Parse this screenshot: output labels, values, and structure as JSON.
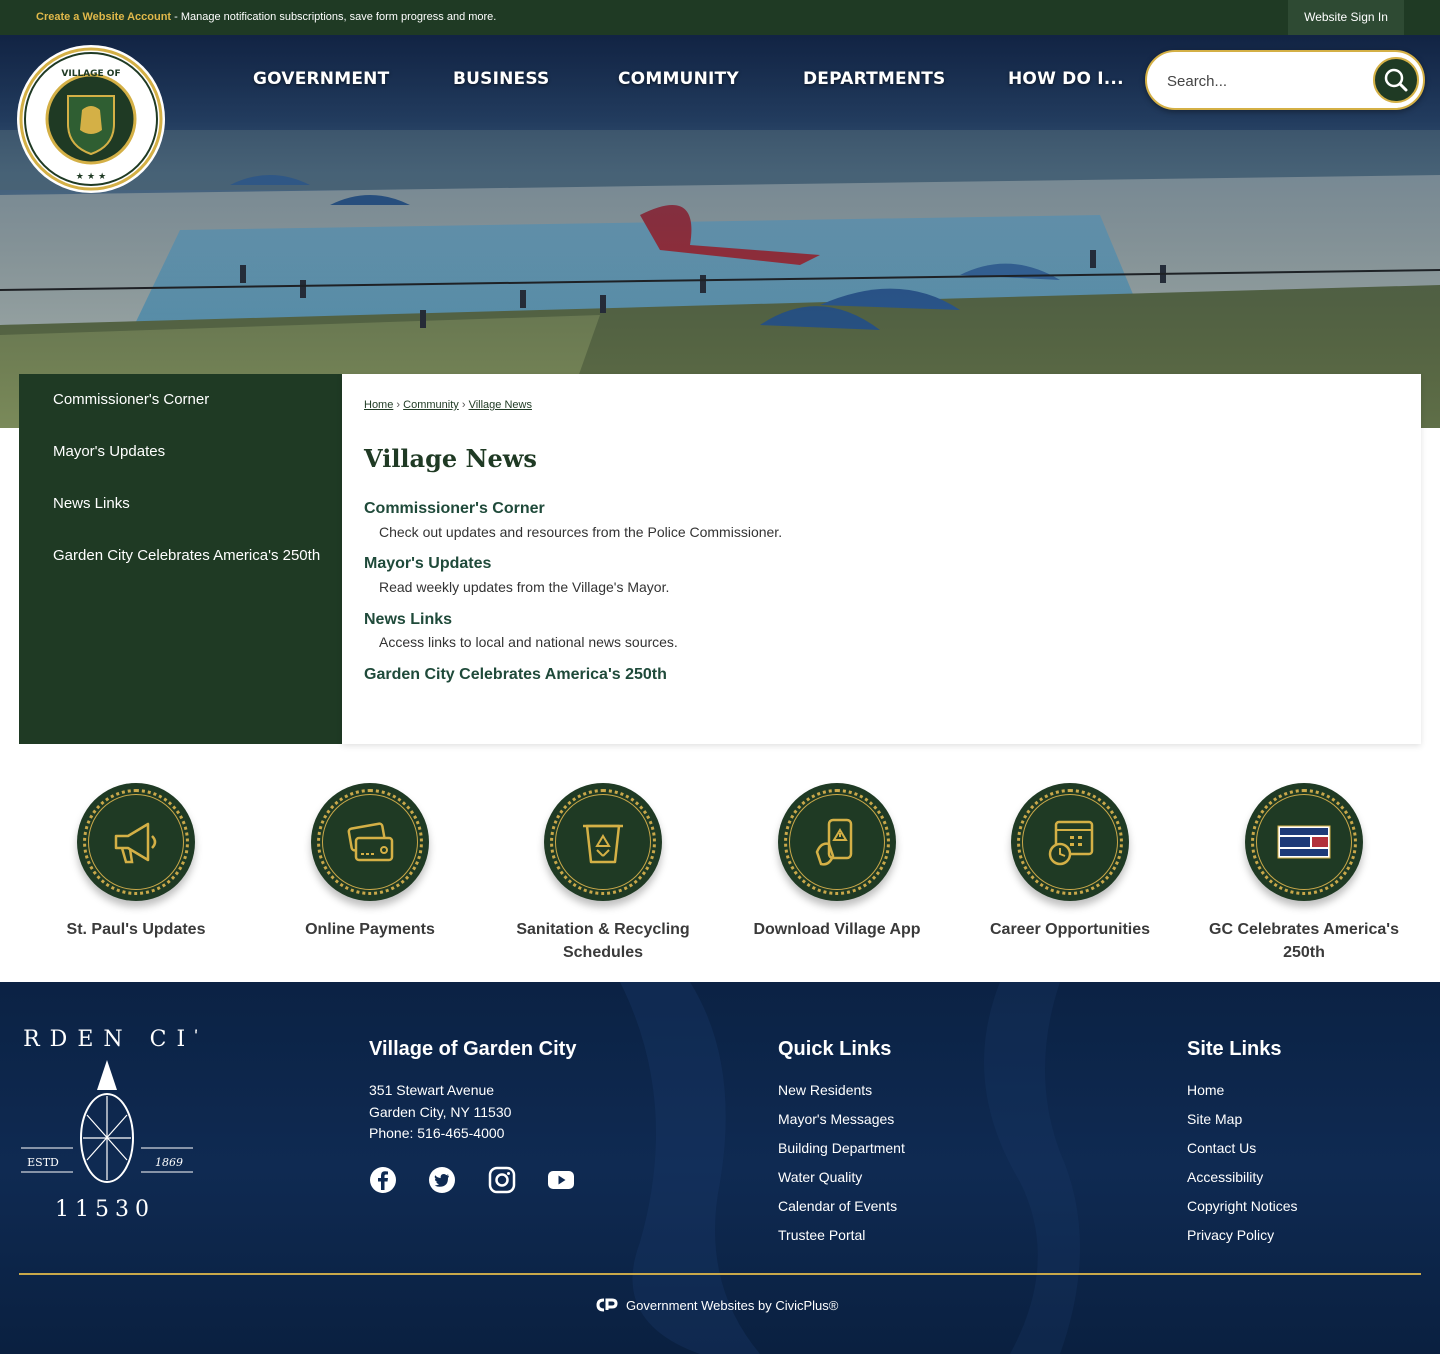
{
  "topbar": {
    "create_account": "Create a Website Account",
    "message": " - Manage notification subscriptions, save form progress and more.",
    "sign_in": "Website Sign In"
  },
  "nav": {
    "items": [
      "GOVERNMENT",
      "BUSINESS",
      "COMMUNITY",
      "DEPARTMENTS",
      "HOW DO I..."
    ]
  },
  "search": {
    "placeholder": "Search..."
  },
  "sidebar": {
    "items": [
      "Commissioner's Corner",
      "Mayor's Updates",
      "News Links",
      "Garden City Celebrates America's 250th"
    ]
  },
  "breadcrumb": {
    "items": [
      "Home",
      "Community",
      "Village News"
    ],
    "separator": "›"
  },
  "page": {
    "title": "Village News",
    "entries": [
      {
        "title": "Commissioner's Corner",
        "desc": "Check out updates and resources from the Police Commissioner."
      },
      {
        "title": "Mayor's Updates",
        "desc": "Read weekly updates from the Village's Mayor."
      },
      {
        "title": "News Links",
        "desc": "Access links to local and national news sources."
      },
      {
        "title": "Garden City Celebrates America's 250th",
        "desc": ""
      }
    ]
  },
  "quick_links": [
    {
      "label": "St. Paul's Updates",
      "icon": "megaphone-icon"
    },
    {
      "label": "Online Payments",
      "icon": "credit-card-icon"
    },
    {
      "label": "Sanitation & Recycling Schedules",
      "icon": "recycling-bin-icon"
    },
    {
      "label": "Download Village App",
      "icon": "phone-alert-icon"
    },
    {
      "label": "Career Opportunities",
      "icon": "calendar-clock-icon"
    },
    {
      "label": "GC Celebrates America's 250th",
      "icon": "america-250-logo"
    }
  ],
  "footer": {
    "village": {
      "heading": "Village of Garden City",
      "address1": "351 Stewart Avenue",
      "address2": "Garden City, NY 11530",
      "phone": "Phone: 516-465-4000"
    },
    "quick_links": {
      "heading": "Quick Links",
      "items": [
        "New Residents",
        "Mayor's Messages",
        "Building Department",
        "Water Quality",
        "Calendar of Events",
        "Trustee Portal"
      ]
    },
    "site_links": {
      "heading": "Site Links",
      "items": [
        "Home",
        "Site Map",
        "Contact Us",
        "Accessibility",
        "Copyright Notices",
        "Privacy Policy"
      ]
    },
    "logo": {
      "words": [
        "GARDEN CITY",
        "ESTD",
        "1869",
        "11530"
      ]
    },
    "social": [
      "facebook-icon",
      "twitter-icon",
      "instagram-icon",
      "youtube-icon"
    ],
    "powered_by": "Government Websites by CivicPlus®"
  },
  "colors": {
    "primary_green": "#1f3a24",
    "gold": "#c9a84a",
    "footer_navy": "#0f2a52"
  }
}
